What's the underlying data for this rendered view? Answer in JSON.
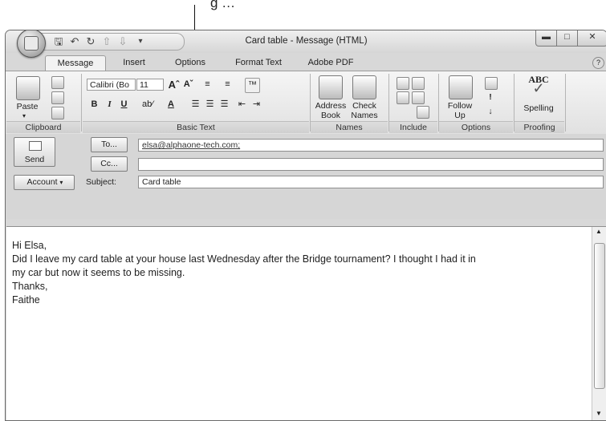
{
  "callout": {
    "text": "g …"
  },
  "window": {
    "title": "Card table - Message (HTML)"
  },
  "tabs": [
    "Message",
    "Insert",
    "Options",
    "Format Text",
    "Adobe PDF"
  ],
  "ribbon": {
    "clipboard": {
      "paste_label": "Paste",
      "group_label": "Clipboard"
    },
    "basic_text": {
      "font_name": "Calibri (Bo",
      "font_size": "11",
      "group_label": "Basic Text"
    },
    "names": {
      "address_book_1": "Address",
      "address_book_2": "Book",
      "check_names_1": "Check",
      "check_names_2": "Names",
      "group_label": "Names"
    },
    "include": {
      "group_label": "Include"
    },
    "options": {
      "follow_up_1": "Follow",
      "follow_up_2": "Up",
      "group_label": "Options"
    },
    "proofing": {
      "spelling_label": "Spelling",
      "abc": "ABC",
      "group_label": "Proofing"
    }
  },
  "compose": {
    "send_label": "Send",
    "to_label": "To...",
    "cc_label": "Cc...",
    "account_label": "Account",
    "subject_label": "Subject:",
    "to_value": "elsa@alphaone-tech.com;",
    "cc_value": "",
    "subject_value": "Card table"
  },
  "message_body": [
    "Hi Elsa,",
    "Did I leave my card table at your house last Wednesday after the Bridge tournament? I thought I had it in",
    "my car but now it seems to be missing.",
    "Thanks,",
    "Faithe"
  ],
  "icons": [
    "office-button-icon",
    "save-icon",
    "undo-icon",
    "redo-icon",
    "up-icon",
    "down-icon",
    "minimize-icon",
    "maximize-icon",
    "close-icon",
    "help-icon",
    "paste-icon",
    "cut-icon",
    "copy-icon",
    "format-painter-icon",
    "address-book-icon",
    "check-names-icon",
    "attach-file-icon",
    "follow-up-flag-icon",
    "spelling-icon"
  ]
}
